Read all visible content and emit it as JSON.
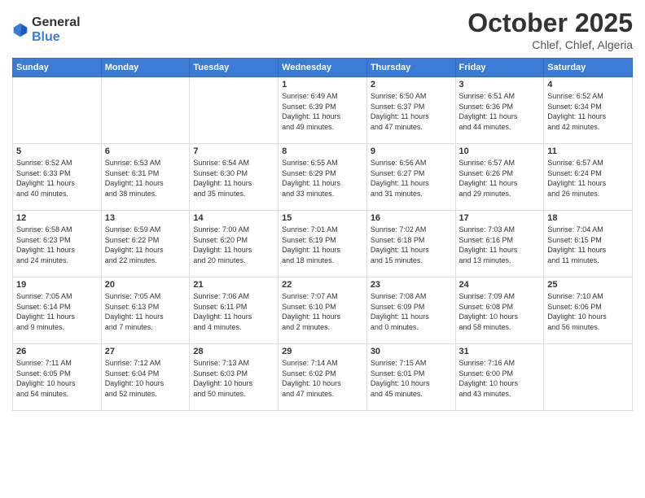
{
  "header": {
    "logo_general": "General",
    "logo_blue": "Blue",
    "month": "October 2025",
    "location": "Chlef, Chlef, Algeria"
  },
  "weekdays": [
    "Sunday",
    "Monday",
    "Tuesday",
    "Wednesday",
    "Thursday",
    "Friday",
    "Saturday"
  ],
  "weeks": [
    [
      {
        "day": "",
        "info": ""
      },
      {
        "day": "",
        "info": ""
      },
      {
        "day": "",
        "info": ""
      },
      {
        "day": "1",
        "info": "Sunrise: 6:49 AM\nSunset: 6:39 PM\nDaylight: 11 hours\nand 49 minutes."
      },
      {
        "day": "2",
        "info": "Sunrise: 6:50 AM\nSunset: 6:37 PM\nDaylight: 11 hours\nand 47 minutes."
      },
      {
        "day": "3",
        "info": "Sunrise: 6:51 AM\nSunset: 6:36 PM\nDaylight: 11 hours\nand 44 minutes."
      },
      {
        "day": "4",
        "info": "Sunrise: 6:52 AM\nSunset: 6:34 PM\nDaylight: 11 hours\nand 42 minutes."
      }
    ],
    [
      {
        "day": "5",
        "info": "Sunrise: 6:52 AM\nSunset: 6:33 PM\nDaylight: 11 hours\nand 40 minutes."
      },
      {
        "day": "6",
        "info": "Sunrise: 6:53 AM\nSunset: 6:31 PM\nDaylight: 11 hours\nand 38 minutes."
      },
      {
        "day": "7",
        "info": "Sunrise: 6:54 AM\nSunset: 6:30 PM\nDaylight: 11 hours\nand 35 minutes."
      },
      {
        "day": "8",
        "info": "Sunrise: 6:55 AM\nSunset: 6:29 PM\nDaylight: 11 hours\nand 33 minutes."
      },
      {
        "day": "9",
        "info": "Sunrise: 6:56 AM\nSunset: 6:27 PM\nDaylight: 11 hours\nand 31 minutes."
      },
      {
        "day": "10",
        "info": "Sunrise: 6:57 AM\nSunset: 6:26 PM\nDaylight: 11 hours\nand 29 minutes."
      },
      {
        "day": "11",
        "info": "Sunrise: 6:57 AM\nSunset: 6:24 PM\nDaylight: 11 hours\nand 26 minutes."
      }
    ],
    [
      {
        "day": "12",
        "info": "Sunrise: 6:58 AM\nSunset: 6:23 PM\nDaylight: 11 hours\nand 24 minutes."
      },
      {
        "day": "13",
        "info": "Sunrise: 6:59 AM\nSunset: 6:22 PM\nDaylight: 11 hours\nand 22 minutes."
      },
      {
        "day": "14",
        "info": "Sunrise: 7:00 AM\nSunset: 6:20 PM\nDaylight: 11 hours\nand 20 minutes."
      },
      {
        "day": "15",
        "info": "Sunrise: 7:01 AM\nSunset: 6:19 PM\nDaylight: 11 hours\nand 18 minutes."
      },
      {
        "day": "16",
        "info": "Sunrise: 7:02 AM\nSunset: 6:18 PM\nDaylight: 11 hours\nand 15 minutes."
      },
      {
        "day": "17",
        "info": "Sunrise: 7:03 AM\nSunset: 6:16 PM\nDaylight: 11 hours\nand 13 minutes."
      },
      {
        "day": "18",
        "info": "Sunrise: 7:04 AM\nSunset: 6:15 PM\nDaylight: 11 hours\nand 11 minutes."
      }
    ],
    [
      {
        "day": "19",
        "info": "Sunrise: 7:05 AM\nSunset: 6:14 PM\nDaylight: 11 hours\nand 9 minutes."
      },
      {
        "day": "20",
        "info": "Sunrise: 7:05 AM\nSunset: 6:13 PM\nDaylight: 11 hours\nand 7 minutes."
      },
      {
        "day": "21",
        "info": "Sunrise: 7:06 AM\nSunset: 6:11 PM\nDaylight: 11 hours\nand 4 minutes."
      },
      {
        "day": "22",
        "info": "Sunrise: 7:07 AM\nSunset: 6:10 PM\nDaylight: 11 hours\nand 2 minutes."
      },
      {
        "day": "23",
        "info": "Sunrise: 7:08 AM\nSunset: 6:09 PM\nDaylight: 11 hours\nand 0 minutes."
      },
      {
        "day": "24",
        "info": "Sunrise: 7:09 AM\nSunset: 6:08 PM\nDaylight: 10 hours\nand 58 minutes."
      },
      {
        "day": "25",
        "info": "Sunrise: 7:10 AM\nSunset: 6:06 PM\nDaylight: 10 hours\nand 56 minutes."
      }
    ],
    [
      {
        "day": "26",
        "info": "Sunrise: 7:11 AM\nSunset: 6:05 PM\nDaylight: 10 hours\nand 54 minutes."
      },
      {
        "day": "27",
        "info": "Sunrise: 7:12 AM\nSunset: 6:04 PM\nDaylight: 10 hours\nand 52 minutes."
      },
      {
        "day": "28",
        "info": "Sunrise: 7:13 AM\nSunset: 6:03 PM\nDaylight: 10 hours\nand 50 minutes."
      },
      {
        "day": "29",
        "info": "Sunrise: 7:14 AM\nSunset: 6:02 PM\nDaylight: 10 hours\nand 47 minutes."
      },
      {
        "day": "30",
        "info": "Sunrise: 7:15 AM\nSunset: 6:01 PM\nDaylight: 10 hours\nand 45 minutes."
      },
      {
        "day": "31",
        "info": "Sunrise: 7:16 AM\nSunset: 6:00 PM\nDaylight: 10 hours\nand 43 minutes."
      },
      {
        "day": "",
        "info": ""
      }
    ]
  ]
}
